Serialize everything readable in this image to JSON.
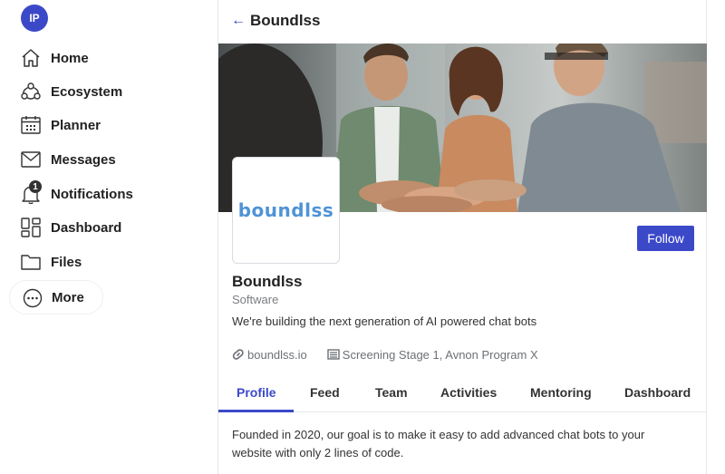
{
  "user": {
    "initials": "IP"
  },
  "sidebar": {
    "items": [
      {
        "label": "Home",
        "icon": "home-icon"
      },
      {
        "label": "Ecosystem",
        "icon": "ecosystem-icon"
      },
      {
        "label": "Planner",
        "icon": "calendar-icon"
      },
      {
        "label": "Messages",
        "icon": "mail-icon"
      },
      {
        "label": "Notifications",
        "icon": "bell-icon",
        "badge": "1"
      },
      {
        "label": "Dashboard",
        "icon": "dashboard-icon"
      },
      {
        "label": "Files",
        "icon": "folder-icon"
      },
      {
        "label": "More",
        "icon": "more-icon"
      }
    ]
  },
  "header": {
    "title": "Boundlss",
    "back_icon": "arrow-left-icon"
  },
  "profile": {
    "logo_text": "boundlss",
    "name": "Boundlss",
    "category": "Software",
    "description": "We're building the next generation of AI powered chat bots",
    "website": "boundlss.io",
    "program": "Screening Stage 1, Avnon Program X",
    "follow_label": "Follow"
  },
  "tabs": [
    {
      "label": "Profile",
      "active": true
    },
    {
      "label": "Feed"
    },
    {
      "label": "Team"
    },
    {
      "label": "Activities"
    },
    {
      "label": "Mentoring"
    },
    {
      "label": "Dashboard"
    }
  ],
  "about": "Founded in 2020, our goal is to make it easy to add advanced chat bots to your website with only 2 lines of code.",
  "colors": {
    "accent": "#3b49c9",
    "logo": "#4f93d8"
  }
}
